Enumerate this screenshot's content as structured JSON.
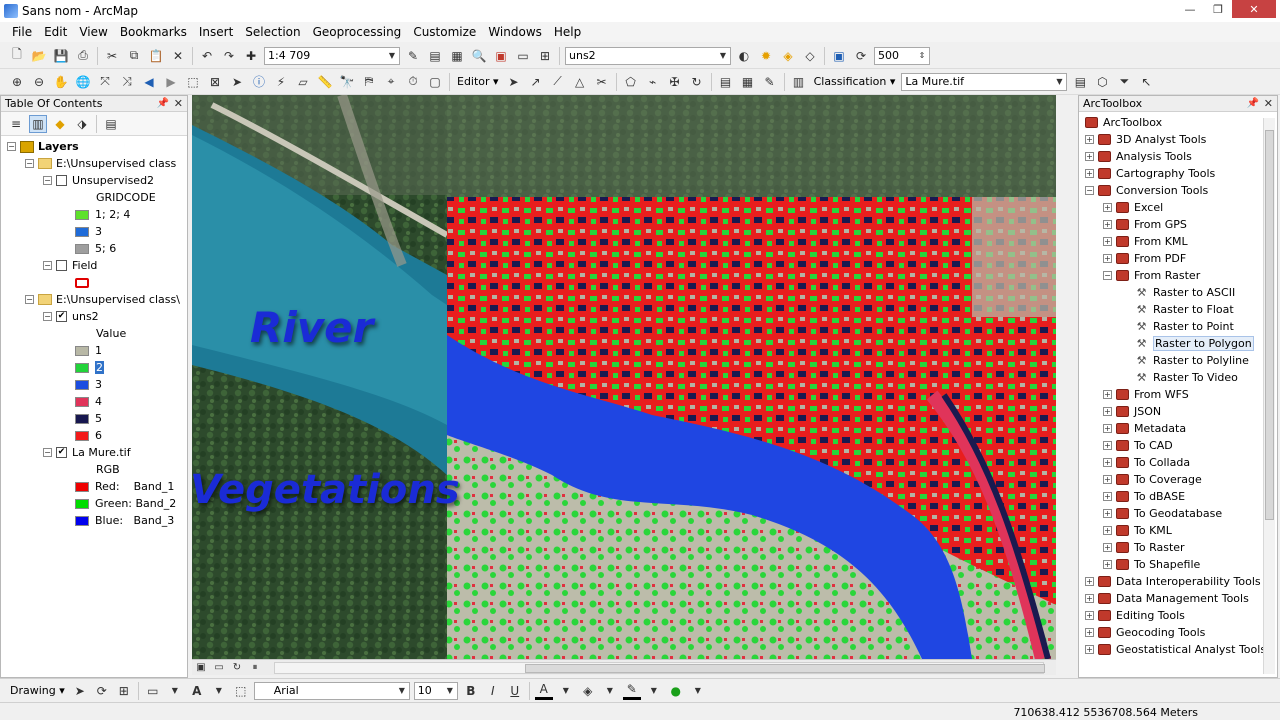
{
  "window": {
    "title": "Sans nom - ArcMap",
    "min": "—",
    "max": "❐",
    "close": "✕"
  },
  "menu": [
    "File",
    "Edit",
    "View",
    "Bookmarks",
    "Insert",
    "Selection",
    "Geoprocessing",
    "Customize",
    "Windows",
    "Help"
  ],
  "standard_toolbar": {
    "scale": "1:4 709",
    "layer_combo": "uns2",
    "value_box": "500"
  },
  "tools_toolbar": {
    "editor_label": "Editor ▾",
    "classification_label": "Classification ▾",
    "raster_combo": "La Mure.tif"
  },
  "toc": {
    "title": "Table Of Contents",
    "root": "Layers",
    "group1": {
      "name": "E:\\Unsupervised class",
      "layer": "Unsupervised2",
      "field_header": "GRIDCODE",
      "classes": [
        {
          "label": "1; 2; 4",
          "color": "#5ee12b"
        },
        {
          "label": "3",
          "color": "#1f6bd8"
        },
        {
          "label": "5; 6",
          "color": "#9e9e9e"
        }
      ]
    },
    "field_layer": "Field",
    "group2": {
      "name": "E:\\Unsupervised class\\",
      "layer": "uns2",
      "value_header": "Value",
      "classes": [
        {
          "label": "1",
          "color": "#b8b8a6"
        },
        {
          "label": "2",
          "color": "#22d33a"
        },
        {
          "label": "3",
          "color": "#1c4de0"
        },
        {
          "label": "4",
          "color": "#e0345a"
        },
        {
          "label": "5",
          "color": "#17174f"
        },
        {
          "label": "6",
          "color": "#f21a1a"
        }
      ]
    },
    "raster": {
      "name": "La Mure.tif",
      "rgb": "RGB",
      "bands": [
        {
          "label": "Red:    Band_1",
          "color": "#ee0000"
        },
        {
          "label": "Green: Band_2",
          "color": "#00dd00"
        },
        {
          "label": "Blue:   Band_3",
          "color": "#0000ee"
        }
      ]
    }
  },
  "map": {
    "label_river": "River",
    "label_veg": "Vegetations"
  },
  "toolbox": {
    "title": "ArcToolbox",
    "root": "ArcToolbox",
    "toolsets_top": [
      "3D Analyst Tools",
      "Analysis Tools",
      "Cartography Tools"
    ],
    "conversion": "Conversion Tools",
    "conversion_children_a": [
      "Excel",
      "From GPS",
      "From KML",
      "From PDF"
    ],
    "from_raster": "From Raster",
    "from_raster_tools": [
      "Raster to ASCII",
      "Raster to Float",
      "Raster to Point",
      "Raster to Polygon",
      "Raster to Polyline",
      "Raster To Video"
    ],
    "conversion_children_b": [
      "From WFS",
      "JSON",
      "Metadata",
      "To CAD",
      "To Collada",
      "To Coverage",
      "To dBASE",
      "To Geodatabase",
      "To KML",
      "To Raster",
      "To Shapefile"
    ],
    "toolsets_bottom": [
      "Data Interoperability Tools",
      "Data Management Tools",
      "Editing Tools",
      "Geocoding Tools",
      "Geostatistical Analyst Tools"
    ]
  },
  "draw_toolbar": {
    "drawing_label": "Drawing ▾",
    "font": "Arial",
    "size": "10"
  },
  "status": {
    "coords": "710638.412  5536708.564 Meters"
  }
}
